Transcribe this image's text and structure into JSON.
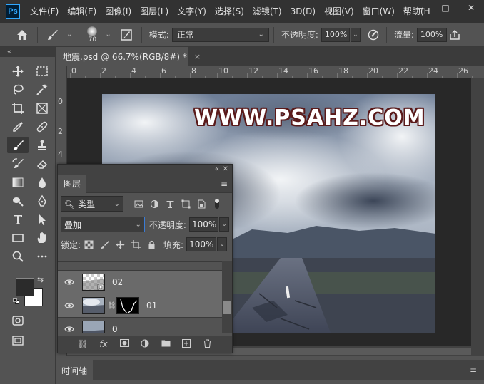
{
  "app": {
    "logo": "Ps",
    "menus": [
      "文件(F)",
      "编辑(E)",
      "图像(I)",
      "图层(L)",
      "文字(Y)",
      "选择(S)",
      "滤镜(T)",
      "3D(D)",
      "视图(V)",
      "窗口(W)",
      "帮助(H"
    ],
    "window_controls": [
      "—",
      "□",
      "✕"
    ]
  },
  "options": {
    "brush_size": "70",
    "mode_label": "模式:",
    "mode_value": "正常",
    "opacity_label": "不透明度:",
    "opacity_value": "100%",
    "flow_label": "流量:",
    "flow_value": "100%"
  },
  "document": {
    "tab_title": "地震.psd @ 66.7%(RGB/8#) *",
    "close": "×"
  },
  "ruler": {
    "h_labels": [
      "0",
      "2",
      "4",
      "6",
      "8",
      "10",
      "12",
      "14",
      "16",
      "18",
      "20",
      "22",
      "24",
      "26"
    ],
    "v_labels": [
      "0",
      "2",
      "4"
    ]
  },
  "watermark": "WWW.PSAHZ.COM",
  "layers_panel": {
    "title": "图层",
    "filter_label": "类型",
    "blend_mode": "叠加",
    "opacity_label": "不透明度:",
    "opacity_value": "100%",
    "lock_label": "锁定:",
    "fill_label": "填充:",
    "fill_value": "100%",
    "layers": [
      {
        "name": "02",
        "selected": true
      },
      {
        "name": "01",
        "selected": true
      },
      {
        "name": "0",
        "selected": false
      }
    ]
  },
  "timeline": {
    "title": "时间轴"
  }
}
